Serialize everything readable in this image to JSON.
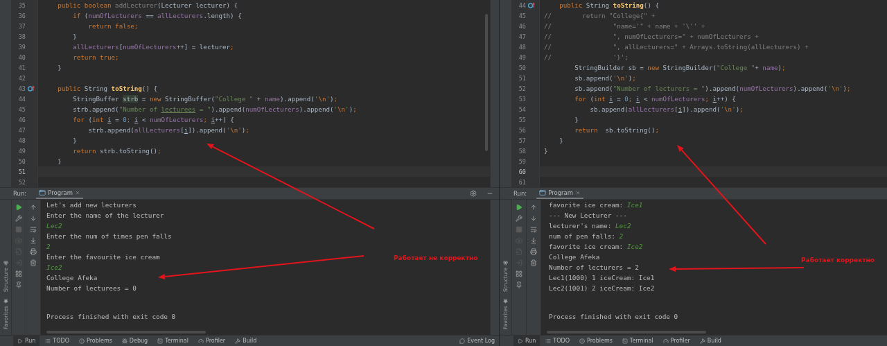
{
  "panes": [
    {
      "editor": {
        "lines": [
          {
            "number": "35",
            "override": false,
            "current": false,
            "tokens": [
              {
                "kind": "kw",
                "text": "    public boolean "
              },
              {
                "kind": "unused",
                "text": "addLecturer"
              },
              {
                "kind": "plain",
                "text": "(Lecturer lecturer) {"
              }
            ]
          },
          {
            "number": "36",
            "override": false,
            "current": false,
            "tokens": [
              {
                "kind": "kw",
                "text": "        if "
              },
              {
                "kind": "plain",
                "text": "("
              },
              {
                "kind": "field",
                "text": "numOfLecturers"
              },
              {
                "kind": "plain",
                "text": " == "
              },
              {
                "kind": "field",
                "text": "allLecturers"
              },
              {
                "kind": "plain",
                "text": ".length) {"
              }
            ]
          },
          {
            "number": "37",
            "override": false,
            "current": false,
            "tokens": [
              {
                "kind": "kw",
                "text": "            return false;"
              }
            ]
          },
          {
            "number": "38",
            "override": false,
            "current": false,
            "tokens": [
              {
                "kind": "plain",
                "text": "        }"
              }
            ]
          },
          {
            "number": "39",
            "override": false,
            "current": false,
            "tokens": [
              {
                "kind": "field",
                "text": "        allLecturers"
              },
              {
                "kind": "plain",
                "text": "["
              },
              {
                "kind": "field",
                "text": "numOfLecturers"
              },
              {
                "kind": "plain",
                "text": "++] = lecturer"
              },
              {
                "kind": "kw",
                "text": ";"
              }
            ]
          },
          {
            "number": "40",
            "override": false,
            "current": false,
            "tokens": [
              {
                "kind": "kw",
                "text": "        return true;"
              }
            ]
          },
          {
            "number": "41",
            "override": false,
            "current": false,
            "tokens": [
              {
                "kind": "plain",
                "text": "    }"
              }
            ]
          },
          {
            "number": "42",
            "override": false,
            "current": false
          },
          {
            "number": "43",
            "override": true,
            "current": false,
            "tokens": [
              {
                "kind": "kw",
                "text": "    public "
              },
              {
                "kind": "plain",
                "text": "String "
              },
              {
                "kind": "method",
                "text": "toString"
              },
              {
                "kind": "plain",
                "text": "() {"
              }
            ]
          },
          {
            "number": "44",
            "override": false,
            "current": false,
            "tokens": [
              {
                "kind": "plain",
                "text": "        StringBuffer "
              },
              {
                "kind": "hl",
                "text": "strb"
              },
              {
                "kind": "plain",
                "text": " = "
              },
              {
                "kind": "kw",
                "text": "new "
              },
              {
                "kind": "plain",
                "text": "StringBuffer("
              },
              {
                "kind": "str",
                "text": "\"College \""
              },
              {
                "kind": "plain",
                "text": " + "
              },
              {
                "kind": "field",
                "text": "name"
              },
              {
                "kind": "plain",
                "text": ").append("
              },
              {
                "kind": "str",
                "text": "'"
              },
              {
                "kind": "kw",
                "text": "\\n"
              },
              {
                "kind": "str",
                "text": "'"
              },
              {
                "kind": "plain",
                "text": ")"
              },
              {
                "kind": "kw",
                "text": ";"
              }
            ]
          },
          {
            "number": "45",
            "override": false,
            "current": false,
            "tokens": [
              {
                "kind": "plain",
                "text": "        strb.append("
              },
              {
                "kind": "str",
                "text": "\"Number of "
              },
              {
                "kind": "strwarn",
                "text": "lecturees"
              },
              {
                "kind": "str",
                "text": " = \""
              },
              {
                "kind": "plain",
                "text": ").append("
              },
              {
                "kind": "field",
                "text": "numOfLecturers"
              },
              {
                "kind": "plain",
                "text": ").append("
              },
              {
                "kind": "str",
                "text": "'"
              },
              {
                "kind": "kw",
                "text": "\\n"
              },
              {
                "kind": "str",
                "text": "'"
              },
              {
                "kind": "plain",
                "text": ")"
              },
              {
                "kind": "kw",
                "text": ";"
              }
            ]
          },
          {
            "number": "46",
            "override": false,
            "current": false,
            "tokens": [
              {
                "kind": "kw",
                "text": "        for "
              },
              {
                "kind": "plain",
                "text": "("
              },
              {
                "kind": "kw",
                "text": "int "
              },
              {
                "kind": "under",
                "text": "i"
              },
              {
                "kind": "plain",
                "text": " = "
              },
              {
                "kind": "num",
                "text": "0"
              },
              {
                "kind": "kw",
                "text": "; "
              },
              {
                "kind": "under",
                "text": "i"
              },
              {
                "kind": "plain",
                "text": " < "
              },
              {
                "kind": "field",
                "text": "numOfLecturers"
              },
              {
                "kind": "kw",
                "text": "; "
              },
              {
                "kind": "under",
                "text": "i"
              },
              {
                "kind": "plain",
                "text": "++) {"
              }
            ]
          },
          {
            "number": "47",
            "override": false,
            "current": false,
            "tokens": [
              {
                "kind": "plain",
                "text": "            strb.append("
              },
              {
                "kind": "field",
                "text": "allLecturers"
              },
              {
                "kind": "plain",
                "text": "["
              },
              {
                "kind": "under",
                "text": "i"
              },
              {
                "kind": "plain",
                "text": "]).append("
              },
              {
                "kind": "str",
                "text": "'"
              },
              {
                "kind": "kw",
                "text": "\\n"
              },
              {
                "kind": "str",
                "text": "'"
              },
              {
                "kind": "plain",
                "text": ")"
              },
              {
                "kind": "kw",
                "text": ";"
              }
            ]
          },
          {
            "number": "48",
            "override": false,
            "current": false,
            "tokens": [
              {
                "kind": "plain",
                "text": "        }"
              }
            ]
          },
          {
            "number": "49",
            "override": false,
            "current": false,
            "tokens": [
              {
                "kind": "kw",
                "text": "        return "
              },
              {
                "kind": "plain",
                "text": "strb.toString()"
              },
              {
                "kind": "kw",
                "text": ";"
              }
            ]
          },
          {
            "number": "50",
            "override": false,
            "current": false,
            "tokens": [
              {
                "kind": "plain",
                "text": "    }"
              }
            ]
          },
          {
            "number": "51",
            "override": false,
            "current": true
          },
          {
            "number": "52",
            "override": false,
            "current": false
          }
        ]
      },
      "run": {
        "label": "Run:",
        "tab": {
          "label": "Program",
          "selected": true
        }
      },
      "console": {
        "lines": [
          {
            "tokens": [
              {
                "kind": "out",
                "text": "Let's add new lecturers"
              }
            ]
          },
          {
            "tokens": [
              {
                "kind": "out",
                "text": "Enter the name of the lecturer"
              }
            ]
          },
          {
            "tokens": [
              {
                "kind": "input",
                "text": "Lec2"
              }
            ]
          },
          {
            "tokens": [
              {
                "kind": "out",
                "text": "Enter the num of times pen falls"
              }
            ]
          },
          {
            "tokens": [
              {
                "kind": "input",
                "text": "2"
              }
            ]
          },
          {
            "tokens": [
              {
                "kind": "out",
                "text": "Enter the favourite ice cream"
              }
            ]
          },
          {
            "tokens": [
              {
                "kind": "input",
                "text": "Ice2"
              }
            ]
          },
          {
            "tokens": [
              {
                "kind": "out",
                "text": "College Afeka"
              }
            ]
          },
          {
            "tokens": [
              {
                "kind": "out",
                "text": "Number of lecturees = 0"
              }
            ]
          }
        ],
        "exit_message": "Process finished with exit code 0"
      },
      "side_tabs": [
        "Structure",
        "Favorites"
      ],
      "bottom_bar": [
        {
          "kind": "run",
          "label": "Run",
          "selected": true
        },
        {
          "kind": "todo",
          "label": "TODO",
          "selected": false
        },
        {
          "kind": "problems",
          "label": "Problems",
          "selected": false
        },
        {
          "kind": "debug",
          "label": "Debug",
          "selected": false
        },
        {
          "kind": "terminal",
          "label": "Terminal",
          "selected": false
        },
        {
          "kind": "profiler",
          "label": "Profiler",
          "selected": false
        },
        {
          "kind": "build",
          "label": "Build",
          "selected": false
        },
        {
          "kind": "eventlog",
          "label": "Event Log",
          "selected": false
        }
      ],
      "annotation": "Работает не корректно"
    },
    {
      "editor": {
        "lines": [
          {
            "number": "44",
            "override": true,
            "current": false,
            "tokens": [
              {
                "kind": "kw",
                "text": "    public "
              },
              {
                "kind": "plain",
                "text": "String "
              },
              {
                "kind": "method",
                "text": "toString"
              },
              {
                "kind": "plain",
                "text": "() {"
              }
            ]
          },
          {
            "number": "45",
            "override": false,
            "current": false,
            "tokens": [
              {
                "kind": "comment",
                "text": "//        return \"College{\" +"
              }
            ]
          },
          {
            "number": "46",
            "override": false,
            "current": false,
            "tokens": [
              {
                "kind": "comment",
                "text": "//                \"name='\" + name + '\\'' +"
              }
            ]
          },
          {
            "number": "47",
            "override": false,
            "current": false,
            "tokens": [
              {
                "kind": "comment",
                "text": "//                \", numOfLecturers=\" + numOfLecturers +"
              }
            ]
          },
          {
            "number": "48",
            "override": false,
            "current": false,
            "tokens": [
              {
                "kind": "comment",
                "text": "//                \", allLecturers=\" + Arrays.toString(allLecturers) +"
              }
            ]
          },
          {
            "number": "49",
            "override": false,
            "current": false,
            "tokens": [
              {
                "kind": "comment",
                "text": "//                '}';"
              }
            ]
          },
          {
            "number": "50",
            "override": false,
            "current": false,
            "tokens": [
              {
                "kind": "plain",
                "text": "        StringBuilder sb = "
              },
              {
                "kind": "kw",
                "text": "new "
              },
              {
                "kind": "plain",
                "text": "StringBuilder("
              },
              {
                "kind": "str",
                "text": "\"College \""
              },
              {
                "kind": "plain",
                "text": "+ "
              },
              {
                "kind": "field",
                "text": "name"
              },
              {
                "kind": "plain",
                "text": ")"
              },
              {
                "kind": "kw",
                "text": ";"
              }
            ]
          },
          {
            "number": "51",
            "override": false,
            "current": false,
            "tokens": [
              {
                "kind": "plain",
                "text": "        sb.append("
              },
              {
                "kind": "str",
                "text": "'"
              },
              {
                "kind": "kw",
                "text": "\\n"
              },
              {
                "kind": "str",
                "text": "'"
              },
              {
                "kind": "plain",
                "text": ")"
              },
              {
                "kind": "kw",
                "text": ";"
              }
            ]
          },
          {
            "number": "52",
            "override": false,
            "current": false,
            "tokens": [
              {
                "kind": "plain",
                "text": "        sb.append("
              },
              {
                "kind": "str",
                "text": "\"Number of lecturers = \""
              },
              {
                "kind": "plain",
                "text": ").append("
              },
              {
                "kind": "field",
                "text": "numOfLecturers"
              },
              {
                "kind": "plain",
                "text": ").append("
              },
              {
                "kind": "str",
                "text": "'"
              },
              {
                "kind": "kw",
                "text": "\\n"
              },
              {
                "kind": "str",
                "text": "'"
              },
              {
                "kind": "plain",
                "text": ")"
              },
              {
                "kind": "kw",
                "text": ";"
              }
            ]
          },
          {
            "number": "53",
            "override": false,
            "current": false,
            "tokens": [
              {
                "kind": "kw",
                "text": "        for "
              },
              {
                "kind": "plain",
                "text": "("
              },
              {
                "kind": "kw",
                "text": "int "
              },
              {
                "kind": "under",
                "text": "i"
              },
              {
                "kind": "plain",
                "text": " = "
              },
              {
                "kind": "num",
                "text": "0"
              },
              {
                "kind": "kw",
                "text": "; "
              },
              {
                "kind": "under",
                "text": "i"
              },
              {
                "kind": "plain",
                "text": " < "
              },
              {
                "kind": "field",
                "text": "numOfLecturers"
              },
              {
                "kind": "kw",
                "text": "; "
              },
              {
                "kind": "under",
                "text": "i"
              },
              {
                "kind": "plain",
                "text": "++) {"
              }
            ]
          },
          {
            "number": "54",
            "override": false,
            "current": false,
            "tokens": [
              {
                "kind": "plain",
                "text": "            sb.append("
              },
              {
                "kind": "field",
                "text": "allLecturers"
              },
              {
                "kind": "plain",
                "text": "["
              },
              {
                "kind": "under",
                "text": "i"
              },
              {
                "kind": "plain",
                "text": "]).append("
              },
              {
                "kind": "str",
                "text": "'"
              },
              {
                "kind": "kw",
                "text": "\\n"
              },
              {
                "kind": "str",
                "text": "'"
              },
              {
                "kind": "plain",
                "text": ")"
              },
              {
                "kind": "kw",
                "text": ";"
              }
            ]
          },
          {
            "number": "55",
            "override": false,
            "current": false,
            "tokens": [
              {
                "kind": "plain",
                "text": "        }"
              }
            ]
          },
          {
            "number": "56",
            "override": false,
            "current": false,
            "tokens": [
              {
                "kind": "kw",
                "text": "        return  "
              },
              {
                "kind": "plain",
                "text": "sb.toString()"
              },
              {
                "kind": "kw",
                "text": ";"
              }
            ]
          },
          {
            "number": "57",
            "override": false,
            "current": false,
            "tokens": [
              {
                "kind": "plain",
                "text": "    }"
              }
            ]
          },
          {
            "number": "58",
            "override": false,
            "current": false,
            "tokens": [
              {
                "kind": "plain",
                "text": "}"
              }
            ]
          },
          {
            "number": "59",
            "override": false,
            "current": false
          },
          {
            "number": "60",
            "override": false,
            "current": true
          },
          {
            "number": "61",
            "override": false,
            "current": false
          }
        ]
      },
      "run": {
        "label": "Run:",
        "tab": {
          "label": "Program",
          "selected": true
        }
      },
      "console": {
        "lines": [
          {
            "tokens": [
              {
                "kind": "out",
                "text": "favorite ice cream: "
              },
              {
                "kind": "input",
                "text": "Ice1"
              }
            ]
          },
          {
            "tokens": [
              {
                "kind": "out",
                "text": "--- New Lecturer ---"
              }
            ]
          },
          {
            "tokens": [
              {
                "kind": "out",
                "text": "lecturer's name: "
              },
              {
                "kind": "input",
                "text": "Lec2"
              }
            ]
          },
          {
            "tokens": [
              {
                "kind": "out",
                "text": "num of pen falls: "
              },
              {
                "kind": "input",
                "text": "2"
              }
            ]
          },
          {
            "tokens": [
              {
                "kind": "out",
                "text": "favorite ice cream: "
              },
              {
                "kind": "input",
                "text": "Ice2"
              }
            ]
          },
          {
            "tokens": [
              {
                "kind": "out",
                "text": "College Afeka"
              }
            ]
          },
          {
            "tokens": [
              {
                "kind": "out",
                "text": "Number of lecturers = 2"
              }
            ]
          },
          {
            "tokens": [
              {
                "kind": "out",
                "text": "Lec1(1000) 1 iceCream: Ice1"
              }
            ]
          },
          {
            "tokens": [
              {
                "kind": "out",
                "text": "Lec2(1001) 2 iceCream: Ice2"
              }
            ]
          }
        ],
        "exit_message": "Process finished with exit code 0"
      },
      "side_tabs": [
        "Structure",
        "Favorites"
      ],
      "bottom_bar": [
        {
          "kind": "run",
          "label": "Run",
          "selected": true
        },
        {
          "kind": "todo",
          "label": "TODO",
          "selected": false
        },
        {
          "kind": "problems",
          "label": "Problems",
          "selected": false
        },
        {
          "kind": "terminal",
          "label": "Terminal",
          "selected": false
        },
        {
          "kind": "profiler",
          "label": "Profiler",
          "selected": false
        },
        {
          "kind": "build",
          "label": "Build",
          "selected": false
        }
      ],
      "annotation": "Работает корректно"
    }
  ]
}
